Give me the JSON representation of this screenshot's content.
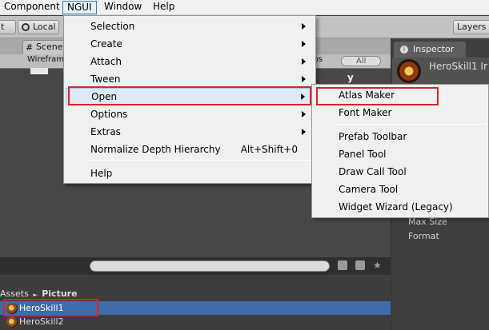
{
  "menubar": {
    "items": [
      {
        "label": "Component"
      },
      {
        "label": "NGUI"
      },
      {
        "label": "Window"
      },
      {
        "label": "Help"
      }
    ]
  },
  "toolbar": {
    "pivot_label": "t",
    "local_label": "Local",
    "layers_label": "Layers"
  },
  "scene": {
    "tab_label": "Scene",
    "render_mode": "Wirefram",
    "gizmos_label": "mos",
    "search_label": "All",
    "axis_label": "y"
  },
  "ngui_menu": {
    "items": [
      {
        "label": "Selection",
        "submenu": true
      },
      {
        "label": "Create",
        "submenu": true
      },
      {
        "label": "Attach",
        "submenu": true
      },
      {
        "label": "Tween",
        "submenu": true
      },
      {
        "label": "Open",
        "submenu": true,
        "highlighted": true
      },
      {
        "label": "Options",
        "submenu": true
      },
      {
        "label": "Extras",
        "submenu": true
      },
      {
        "label": "Normalize Depth Hierarchy",
        "shortcut": "Alt+Shift+0"
      },
      {
        "label": "Help"
      }
    ]
  },
  "open_submenu": {
    "items": [
      {
        "label": "Atlas Maker",
        "highlighted": true
      },
      {
        "label": "Font Maker"
      },
      {
        "label": "Prefab Toolbar"
      },
      {
        "label": "Panel Tool"
      },
      {
        "label": "Draw Call Tool"
      },
      {
        "label": "Camera Tool"
      },
      {
        "label": "Widget Wizard (Legacy)"
      }
    ]
  },
  "project": {
    "breadcrumb": {
      "root": "Assets",
      "sep": "►",
      "current": "Picture"
    },
    "files": [
      {
        "name": "HeroSkill1",
        "selected": true
      },
      {
        "name": "HeroSkill2",
        "selected": false
      }
    ]
  },
  "inspector": {
    "tab_label": "Inspector",
    "object_name": "HeroSkill1 Ir",
    "fields": [
      {
        "label": "Max Size"
      },
      {
        "label": "Format"
      }
    ]
  },
  "colors": {
    "highlight_box": "#d6262b",
    "selection": "#3d6ca9"
  }
}
